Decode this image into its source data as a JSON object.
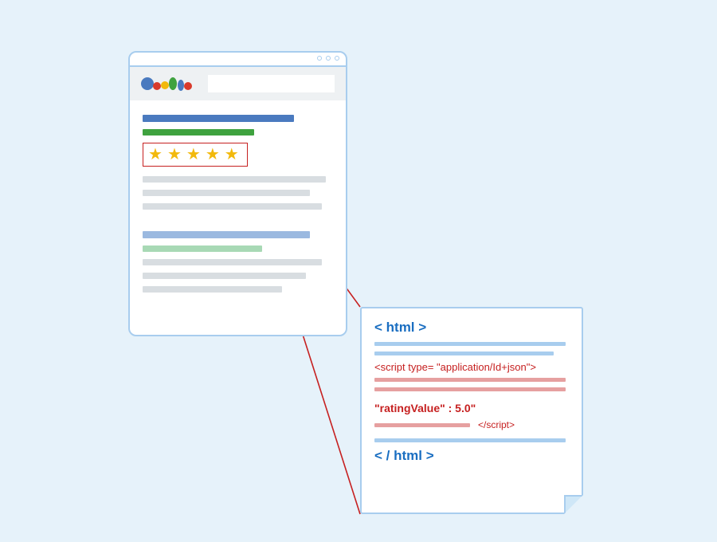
{
  "rating": {
    "stars": "★★★★★"
  },
  "code": {
    "open_html": "< html >",
    "script_open": "<script type= \"application/Id+json\">",
    "rating_line": "\"ratingValue\" : 5.0\"",
    "script_close": "</script>",
    "close_html": "< / html >"
  }
}
